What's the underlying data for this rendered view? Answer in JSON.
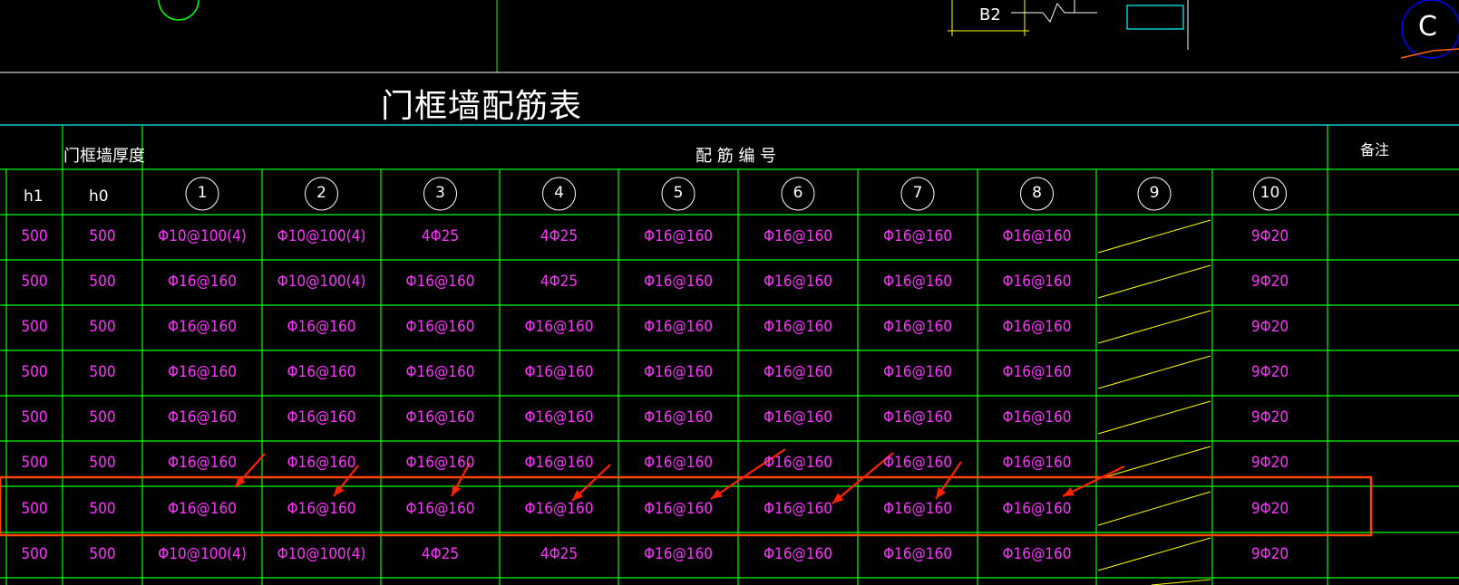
{
  "drawing": {
    "title": "门框墙配筋表",
    "tag_b2": "B2",
    "circle_c": "C"
  },
  "table": {
    "header_thickness": "门框墙厚度",
    "header_rebar_no": "配 筋 编 号",
    "header_remark": "备注",
    "sub_h1": "h1",
    "sub_h0": "h0",
    "rebar_numbers": [
      "1",
      "2",
      "3",
      "4",
      "5",
      "6",
      "7",
      "8",
      "9",
      "10"
    ],
    "rows": [
      {
        "h1": "500",
        "h0": "500",
        "c": [
          "Φ10@100(4)",
          "Φ10@100(4)",
          "4Φ25",
          "4Φ25",
          "Φ16@160",
          "Φ16@160",
          "Φ16@160",
          "Φ16@160",
          "",
          "9Φ20"
        ]
      },
      {
        "h1": "500",
        "h0": "500",
        "c": [
          "Φ16@160",
          "Φ10@100(4)",
          "Φ16@160",
          "4Φ25",
          "Φ16@160",
          "Φ16@160",
          "Φ16@160",
          "Φ16@160",
          "",
          "9Φ20"
        ]
      },
      {
        "h1": "500",
        "h0": "500",
        "c": [
          "Φ16@160",
          "Φ16@160",
          "Φ16@160",
          "Φ16@160",
          "Φ16@160",
          "Φ16@160",
          "Φ16@160",
          "Φ16@160",
          "",
          "9Φ20"
        ]
      },
      {
        "h1": "500",
        "h0": "500",
        "c": [
          "Φ16@160",
          "Φ16@160",
          "Φ16@160",
          "Φ16@160",
          "Φ16@160",
          "Φ16@160",
          "Φ16@160",
          "Φ16@160",
          "",
          "9Φ20"
        ]
      },
      {
        "h1": "500",
        "h0": "500",
        "c": [
          "Φ16@160",
          "Φ16@160",
          "Φ16@160",
          "Φ16@160",
          "Φ16@160",
          "Φ16@160",
          "Φ16@160",
          "Φ16@160",
          "",
          "9Φ20"
        ]
      },
      {
        "h1": "500",
        "h0": "500",
        "c": [
          "Φ16@160",
          "Φ16@160",
          "Φ16@160",
          "Φ16@160",
          "Φ16@160",
          "Φ16@160",
          "Φ16@160",
          "Φ16@160",
          "",
          "9Φ20"
        ]
      },
      {
        "h1": "500",
        "h0": "500",
        "c": [
          "Φ16@160",
          "Φ16@160",
          "Φ16@160",
          "Φ16@160",
          "Φ16@160",
          "Φ16@160",
          "Φ16@160",
          "Φ16@160",
          "",
          "9Φ20"
        ]
      },
      {
        "h1": "500",
        "h0": "500",
        "c": [
          "Φ10@100(4)",
          "Φ10@100(4)",
          "4Φ25",
          "4Φ25",
          "Φ16@160",
          "Φ16@160",
          "Φ16@160",
          "Φ16@160",
          "",
          "9Φ20"
        ]
      }
    ]
  },
  "colors": {
    "grid": "#00ff00",
    "text_cell": "#ff33ff",
    "text_header": "#ffffff",
    "highlight": "#ff4400",
    "hatch": "#ffff00",
    "cyan": "#00cccc"
  }
}
